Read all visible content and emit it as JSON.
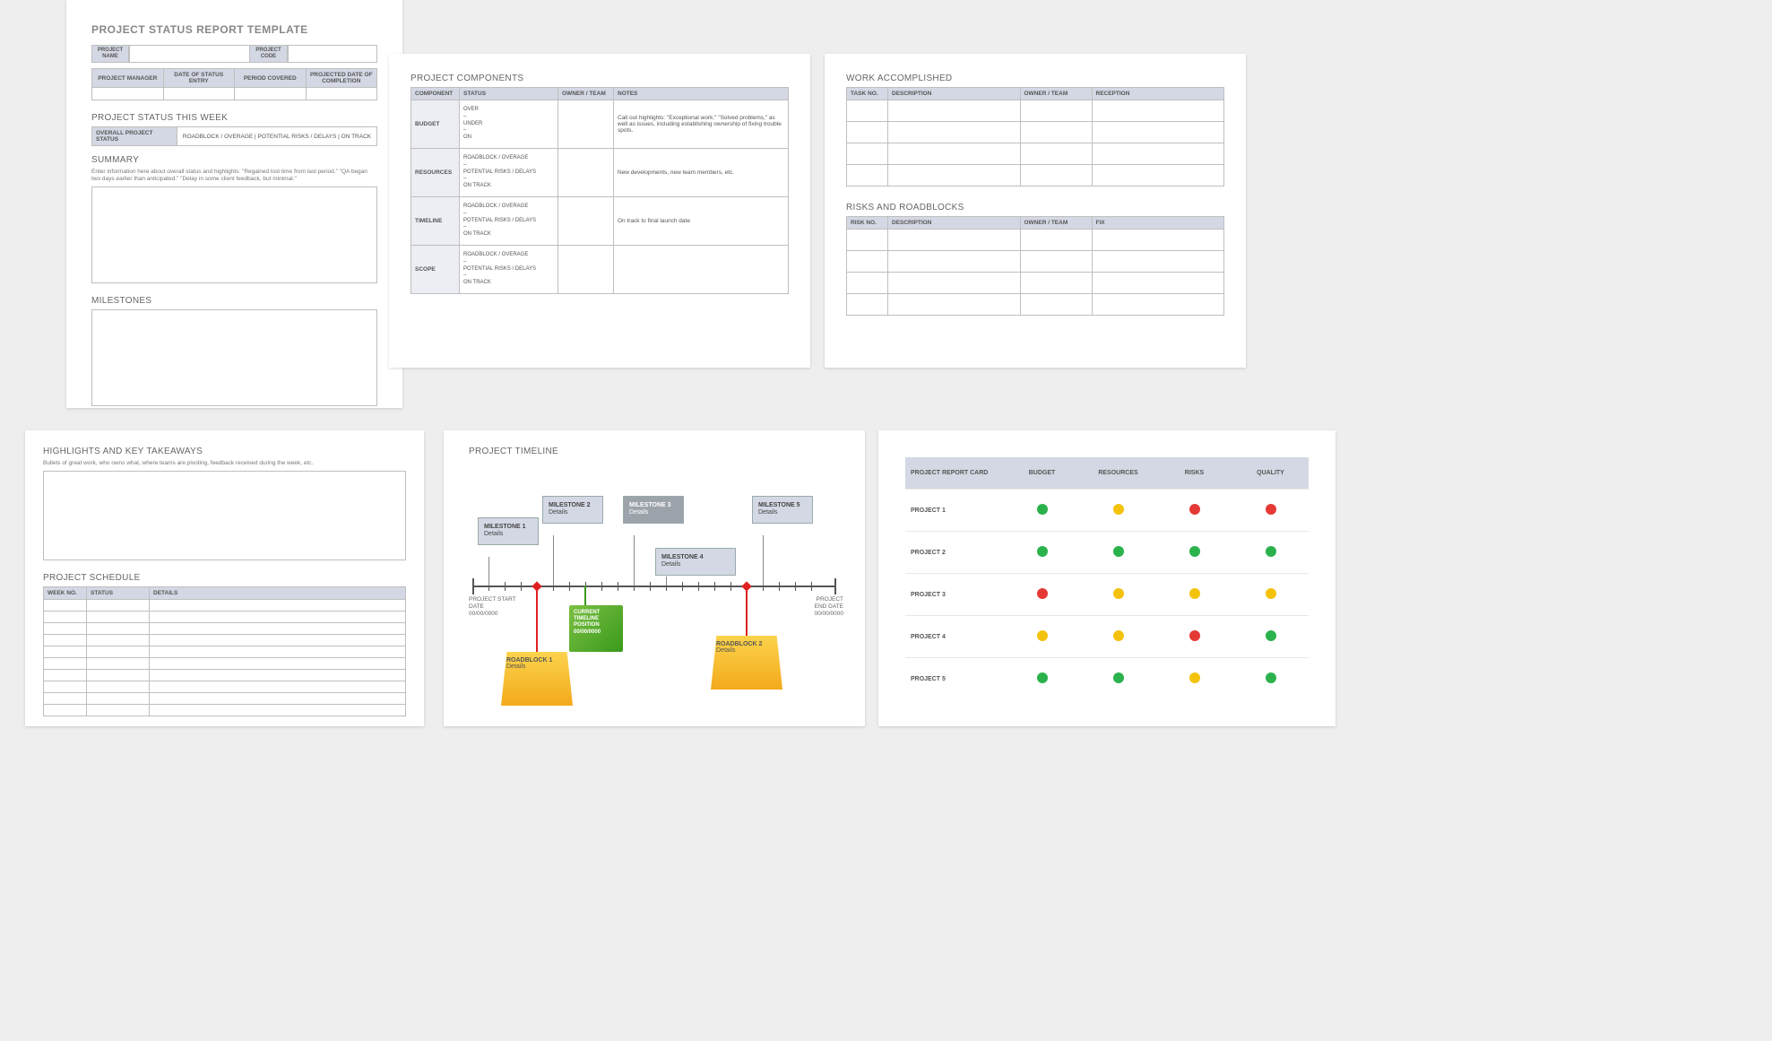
{
  "page1": {
    "title": "PROJECT STATUS REPORT TEMPLATE",
    "row1": {
      "projectName": "PROJECT NAME",
      "projectCode": "PROJECT CODE"
    },
    "row2": {
      "manager": "PROJECT MANAGER",
      "date": "DATE OF STATUS ENTRY",
      "period": "PERIOD COVERED",
      "projected": "PROJECTED DATE OF COMPLETION"
    },
    "statusWeek": "PROJECT STATUS THIS WEEK",
    "overallLabel": "OVERALL PROJECT STATUS",
    "statusOptions": "ROADBLOCK / OVERAGE    |    POTENTIAL RISKS / DELAYS    |    ON TRACK",
    "summaryLabel": "SUMMARY",
    "summaryHint": "Enter information here about overall status and highlights: \"Regained lost time from last period.\" \"QA began two days earlier than anticipated.\" \"Delay in some client feedback, but minimal.\"",
    "milestonesLabel": "MILESTONES"
  },
  "page2": {
    "title": "PROJECT COMPONENTS",
    "headers": {
      "component": "COMPONENT",
      "status": "STATUS",
      "owner": "OWNER / TEAM",
      "notes": "NOTES"
    },
    "rows": [
      {
        "component": "BUDGET",
        "status": "OVER\n–\nUNDER\n–\nON",
        "notes": "Call out highlights: \"Exceptional work.\" \"Solved problems,\" as well as issues, including establishing ownership of fixing trouble spots."
      },
      {
        "component": "RESOURCES",
        "status": "ROADBLOCK / OVERAGE\n–\nPOTENTIAL RISKS / DELAYS\n–\nON TRACK",
        "notes": "New developments, new team members, etc."
      },
      {
        "component": "TIMELINE",
        "status": "ROADBLOCK / OVERAGE\n–\nPOTENTIAL RISKS / DELAYS\n–\nON TRACK",
        "notes": "On track to final launch date"
      },
      {
        "component": "SCOPE",
        "status": "ROADBLOCK / OVERAGE\n–\nPOTENTIAL RISKS / DELAYS\n–\nON TRACK",
        "notes": ""
      }
    ]
  },
  "page3": {
    "workTitle": "WORK ACCOMPLISHED",
    "workHeaders": {
      "task": "TASK NO.",
      "desc": "DESCRIPTION",
      "owner": "OWNER / TEAM",
      "reception": "RECEPTION"
    },
    "risksTitle": "RISKS AND ROADBLOCKS",
    "risksHeaders": {
      "risk": "RISK NO.",
      "desc": "DESCRIPTION",
      "owner": "OWNER / TEAM",
      "fix": "FIX"
    }
  },
  "page4": {
    "highlightsTitle": "HIGHLIGHTS AND KEY TAKEAWAYS",
    "highlightsHint": "Bullets of great work, who owns what, where teams are pivoting, feedback received during the week, etc.",
    "scheduleTitle": "PROJECT SCHEDULE",
    "scheduleHeaders": {
      "week": "WEEK NO.",
      "status": "STATUS",
      "details": "DETAILS"
    }
  },
  "page5": {
    "title": "PROJECT TIMELINE",
    "milestones": [
      {
        "label": "MILESTONE 1",
        "sub": "Details"
      },
      {
        "label": "MILESTONE 2",
        "sub": "Details"
      },
      {
        "label": "MILESTONE 3",
        "sub": "Details"
      },
      {
        "label": "MILESTONE 4",
        "sub": "Details"
      },
      {
        "label": "MILESTONE 5",
        "sub": "Details"
      }
    ],
    "current": {
      "l1": "CURRENT",
      "l2": "TIMELINE",
      "l3": "POSITION",
      "l4": "00/00/0000"
    },
    "roadblocks": [
      {
        "label": "ROADBLOCK 1",
        "sub": "Details"
      },
      {
        "label": "ROADBLOCK 2",
        "sub": "Details"
      }
    ],
    "start": {
      "l1": "PROJECT START",
      "l2": "DATE",
      "l3": "00/00/0000"
    },
    "end": {
      "l1": "PROJECT",
      "l2": "END DATE",
      "l3": "00/00/0000"
    }
  },
  "page6": {
    "headers": {
      "card": "PROJECT REPORT CARD",
      "budget": "BUDGET",
      "resources": "RESOURCES",
      "risks": "RISKS",
      "quality": "QUALITY"
    },
    "rows": [
      {
        "name": "PROJECT 1",
        "cells": [
          "g",
          "y",
          "r",
          "r"
        ]
      },
      {
        "name": "PROJECT 2",
        "cells": [
          "g",
          "g",
          "g",
          "g"
        ]
      },
      {
        "name": "PROJECT 3",
        "cells": [
          "r",
          "y",
          "y",
          "y"
        ]
      },
      {
        "name": "PROJECT 4",
        "cells": [
          "y",
          "y",
          "r",
          "g"
        ]
      },
      {
        "name": "PROJECT 5",
        "cells": [
          "g",
          "g",
          "y",
          "g"
        ]
      }
    ]
  }
}
